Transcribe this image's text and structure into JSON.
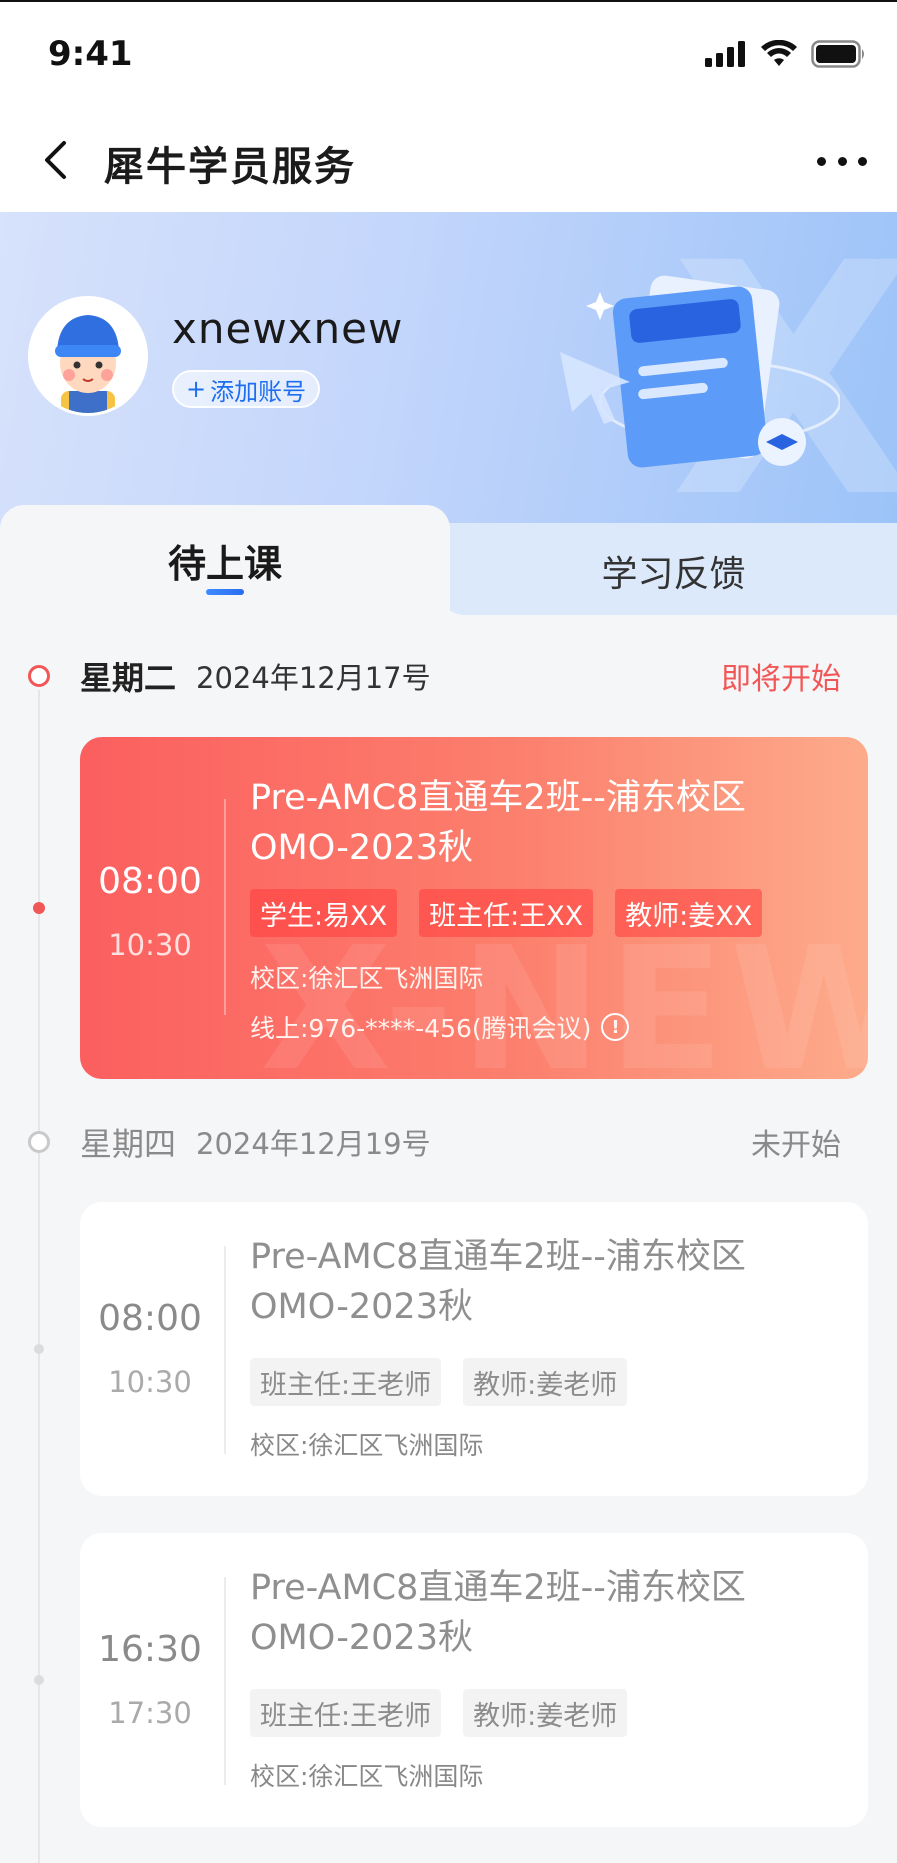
{
  "status_bar": {
    "time": "9:41"
  },
  "nav": {
    "title": "犀牛学员服务"
  },
  "profile": {
    "username": "xnewxnew",
    "add_account": "添加账号"
  },
  "tabs": [
    {
      "label": "待上课",
      "active": true
    },
    {
      "label": "学习反馈",
      "active": false
    }
  ],
  "schedule": [
    {
      "day": "星期二",
      "date": "2024年12月17号",
      "status": "即将开始",
      "status_color": "#f25757",
      "classes": [
        {
          "start": "08:00",
          "end": "10:30",
          "title_line1": "Pre-AMC8直通车2班--浦东校区",
          "title_line2": "OMO-2023秋",
          "tags": [
            "学生:易XX",
            "班主任:王XX",
            "教师:姜XX"
          ],
          "campus": "校区:徐汇区飞洲国际",
          "online": "线上:976-****-456(腾讯会议)",
          "watermark": "X-NEW"
        }
      ]
    },
    {
      "day": "星期四",
      "date": "2024年12月19号",
      "status": "未开始",
      "status_color": "#8a8a8a",
      "classes": [
        {
          "start": "08:00",
          "end": "10:30",
          "title_line1": "Pre-AMC8直通车2班--浦东校区",
          "title_line2": "OMO-2023秋",
          "tags": [
            "班主任:王老师",
            "教师:姜老师"
          ],
          "campus": "校区:徐汇区飞洲国际"
        },
        {
          "start": "16:30",
          "end": "17:30",
          "title_line1": "Pre-AMC8直通车2班--浦东校区",
          "title_line2": "OMO-2023秋",
          "tags": [
            "班主任:王老师",
            "教师:姜老师"
          ],
          "campus": "校区:徐汇区飞洲国际"
        }
      ]
    }
  ],
  "colors": {
    "accent_red": "#f25757",
    "accent_blue": "#2a6cf0"
  },
  "icons": [
    "back-icon",
    "more-icon",
    "signal-icon",
    "wifi-icon",
    "battery-icon",
    "info-icon",
    "plus-icon"
  ]
}
